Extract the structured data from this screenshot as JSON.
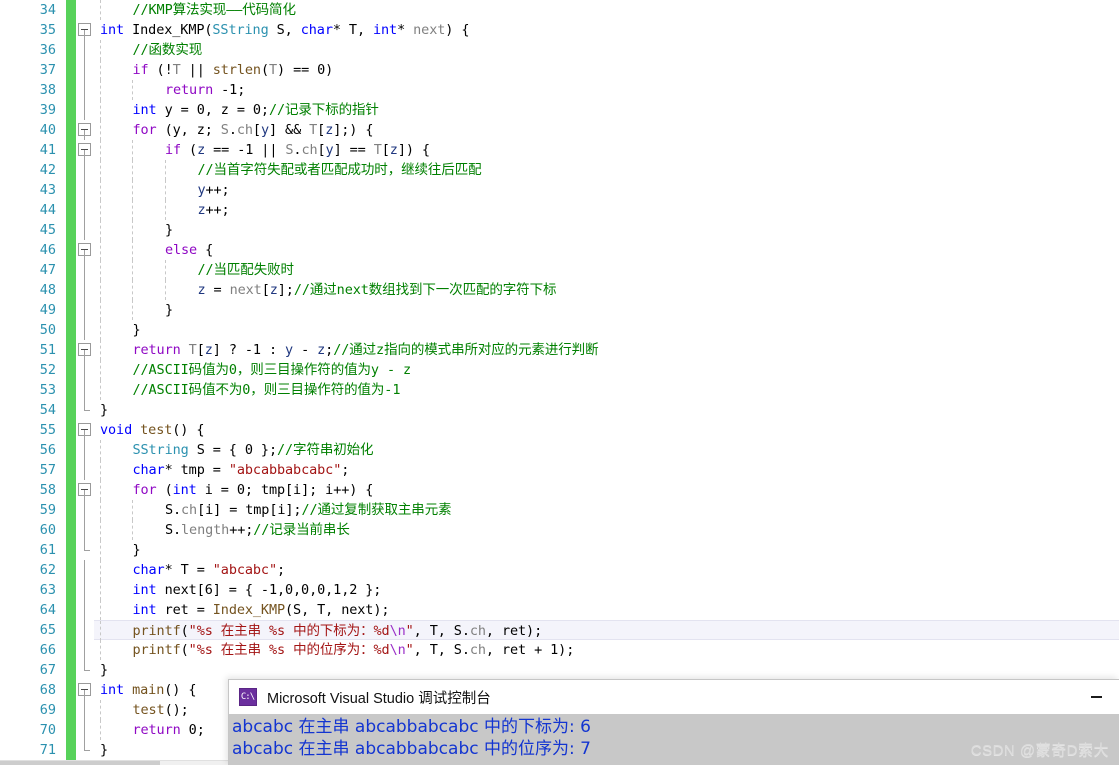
{
  "editor": {
    "language": "cpp",
    "gutter": {
      "change_bar_color": "#57d25a",
      "line_number_color": "#2b91af"
    },
    "first_line_number": 34,
    "current_line_number": 65,
    "lines": [
      {
        "n": 34,
        "indent": 1,
        "tokens": [
          [
            "cmt",
            "//KMP算法实现——代码简化"
          ]
        ]
      },
      {
        "n": 35,
        "indent": 0,
        "fold": "box",
        "tokens": [
          [
            "kw",
            "int"
          ],
          [
            "id",
            " Index_KMP("
          ],
          [
            "type",
            "SString"
          ],
          [
            "id",
            " S, "
          ],
          [
            "kw",
            "char"
          ],
          [
            "id",
            "* T, "
          ],
          [
            "kw",
            "int"
          ],
          [
            "id",
            "* "
          ],
          [
            "var",
            "next"
          ],
          [
            "id",
            ") {"
          ]
        ]
      },
      {
        "n": 36,
        "indent": 1,
        "fold": "line",
        "tokens": [
          [
            "cmt",
            "//函数实现"
          ]
        ]
      },
      {
        "n": 37,
        "indent": 1,
        "fold": "line",
        "tokens": [
          [
            "ctl",
            "if"
          ],
          [
            "id",
            " (!"
          ],
          [
            "var",
            "T"
          ],
          [
            "id",
            " || "
          ],
          [
            "fn",
            "strlen"
          ],
          [
            "id",
            "("
          ],
          [
            "var",
            "T"
          ],
          [
            "id",
            ") == 0)"
          ]
        ]
      },
      {
        "n": 38,
        "indent": 2,
        "fold": "line",
        "tokens": [
          [
            "ctl",
            "return"
          ],
          [
            "id",
            " -1;"
          ]
        ]
      },
      {
        "n": 39,
        "indent": 1,
        "fold": "line",
        "tokens": [
          [
            "kw",
            "int"
          ],
          [
            "id",
            " y = 0, z = 0;"
          ],
          [
            "cmt",
            "//记录下标的指针"
          ]
        ]
      },
      {
        "n": 40,
        "indent": 1,
        "fold": "box",
        "tokens": [
          [
            "ctl",
            "for"
          ],
          [
            "id",
            " (y, z; "
          ],
          [
            "var",
            "S"
          ],
          [
            "id",
            "."
          ],
          [
            "var",
            "ch"
          ],
          [
            "id",
            "["
          ],
          [
            "loc",
            "y"
          ],
          [
            "id",
            "] && "
          ],
          [
            "var",
            "T"
          ],
          [
            "id",
            "["
          ],
          [
            "loc",
            "z"
          ],
          [
            "id",
            "];) {"
          ]
        ]
      },
      {
        "n": 41,
        "indent": 2,
        "fold": "box",
        "tokens": [
          [
            "ctl",
            "if"
          ],
          [
            "id",
            " ("
          ],
          [
            "loc",
            "z"
          ],
          [
            "id",
            " == -1 || "
          ],
          [
            "var",
            "S"
          ],
          [
            "id",
            "."
          ],
          [
            "var",
            "ch"
          ],
          [
            "id",
            "["
          ],
          [
            "loc",
            "y"
          ],
          [
            "id",
            "] == "
          ],
          [
            "var",
            "T"
          ],
          [
            "id",
            "["
          ],
          [
            "loc",
            "z"
          ],
          [
            "id",
            "]) {"
          ]
        ]
      },
      {
        "n": 42,
        "indent": 3,
        "fold": "line",
        "tokens": [
          [
            "cmt",
            "//当首字符失配或者匹配成功时，继续往后匹配"
          ]
        ]
      },
      {
        "n": 43,
        "indent": 3,
        "fold": "line",
        "tokens": [
          [
            "loc",
            "y"
          ],
          [
            "id",
            "++;"
          ]
        ]
      },
      {
        "n": 44,
        "indent": 3,
        "fold": "line",
        "tokens": [
          [
            "loc",
            "z"
          ],
          [
            "id",
            "++;"
          ]
        ]
      },
      {
        "n": 45,
        "indent": 2,
        "fold": "line",
        "tokens": [
          [
            "id",
            "}"
          ]
        ]
      },
      {
        "n": 46,
        "indent": 2,
        "fold": "box",
        "tokens": [
          [
            "ctl",
            "else"
          ],
          [
            "id",
            " {"
          ]
        ]
      },
      {
        "n": 47,
        "indent": 3,
        "fold": "line",
        "tokens": [
          [
            "cmt",
            "//当匹配失败时"
          ]
        ]
      },
      {
        "n": 48,
        "indent": 3,
        "fold": "line",
        "tokens": [
          [
            "loc",
            "z"
          ],
          [
            "id",
            " = "
          ],
          [
            "var",
            "next"
          ],
          [
            "id",
            "["
          ],
          [
            "loc",
            "z"
          ],
          [
            "id",
            "];"
          ],
          [
            "cmt",
            "//通过next数组找到下一次匹配的字符下标"
          ]
        ]
      },
      {
        "n": 49,
        "indent": 2,
        "fold": "line",
        "tokens": [
          [
            "id",
            "}"
          ]
        ]
      },
      {
        "n": 50,
        "indent": 1,
        "fold": "line",
        "tokens": [
          [
            "id",
            "}"
          ]
        ]
      },
      {
        "n": 51,
        "indent": 1,
        "fold": "box",
        "tokens": [
          [
            "ctl",
            "return"
          ],
          [
            "id",
            " "
          ],
          [
            "var",
            "T"
          ],
          [
            "id",
            "["
          ],
          [
            "loc",
            "z"
          ],
          [
            "id",
            "] ? -1 : "
          ],
          [
            "loc",
            "y"
          ],
          [
            "id",
            " - "
          ],
          [
            "loc",
            "z"
          ],
          [
            "id",
            ";"
          ],
          [
            "cmt",
            "//通过z指向的模式串所对应的元素进行判断"
          ]
        ]
      },
      {
        "n": 52,
        "indent": 1,
        "fold": "line",
        "tokens": [
          [
            "cmt",
            "//ASCII码值为0，则三目操作符的值为y - z"
          ]
        ]
      },
      {
        "n": 53,
        "indent": 1,
        "fold": "line",
        "tokens": [
          [
            "cmt",
            "//ASCII码值不为0，则三目操作符的值为-1"
          ]
        ]
      },
      {
        "n": 54,
        "indent": 0,
        "fold": "endline",
        "tokens": [
          [
            "id",
            "}"
          ]
        ]
      },
      {
        "n": 55,
        "indent": 0,
        "fold": "box",
        "tokens": [
          [
            "kw",
            "void"
          ],
          [
            "id",
            " "
          ],
          [
            "fn",
            "test"
          ],
          [
            "id",
            "() {"
          ]
        ]
      },
      {
        "n": 56,
        "indent": 1,
        "fold": "line",
        "tokens": [
          [
            "type",
            "SString"
          ],
          [
            "id",
            " S = { 0 };"
          ],
          [
            "cmt",
            "//字符串初始化"
          ]
        ]
      },
      {
        "n": 57,
        "indent": 1,
        "fold": "line",
        "tokens": [
          [
            "kw",
            "char"
          ],
          [
            "id",
            "* tmp = "
          ],
          [
            "str",
            "\"abcabbabcabc\""
          ],
          [
            "id",
            ";"
          ]
        ]
      },
      {
        "n": 58,
        "indent": 1,
        "fold": "box",
        "tokens": [
          [
            "ctl",
            "for"
          ],
          [
            "id",
            " ("
          ],
          [
            "kw",
            "int"
          ],
          [
            "id",
            " i = 0; tmp[i]; i++) {"
          ]
        ]
      },
      {
        "n": 59,
        "indent": 2,
        "fold": "line",
        "tokens": [
          [
            "id",
            "S."
          ],
          [
            "var",
            "ch"
          ],
          [
            "id",
            "[i] = tmp[i];"
          ],
          [
            "cmt",
            "//通过复制获取主串元素"
          ]
        ]
      },
      {
        "n": 60,
        "indent": 2,
        "fold": "line",
        "tokens": [
          [
            "id",
            "S."
          ],
          [
            "var",
            "length"
          ],
          [
            "id",
            "++;"
          ],
          [
            "cmt",
            "//记录当前串长"
          ]
        ]
      },
      {
        "n": 61,
        "indent": 1,
        "fold": "endline",
        "tokens": [
          [
            "id",
            "}"
          ]
        ]
      },
      {
        "n": 62,
        "indent": 1,
        "fold": "line",
        "tokens": [
          [
            "kw",
            "char"
          ],
          [
            "id",
            "* T = "
          ],
          [
            "str",
            "\"abcabc\""
          ],
          [
            "id",
            ";"
          ]
        ]
      },
      {
        "n": 63,
        "indent": 1,
        "fold": "line",
        "tokens": [
          [
            "kw",
            "int"
          ],
          [
            "id",
            " next[6] = { -1,0,0,0,1,2 };"
          ]
        ]
      },
      {
        "n": 64,
        "indent": 1,
        "fold": "line",
        "tokens": [
          [
            "kw",
            "int"
          ],
          [
            "id",
            " ret = "
          ],
          [
            "fn",
            "Index_KMP"
          ],
          [
            "id",
            "(S, T, next);"
          ]
        ]
      },
      {
        "n": 65,
        "indent": 1,
        "fold": "line",
        "current": true,
        "tokens": [
          [
            "fn",
            "printf"
          ],
          [
            "id",
            "("
          ],
          [
            "str",
            "\"%s 在主串 %s 中的下标为："
          ],
          [
            "str",
            "%d"
          ],
          [
            "esc",
            "\\n"
          ],
          [
            "str",
            "\""
          ],
          [
            "id",
            ", T, S."
          ],
          [
            "var",
            "ch"
          ],
          [
            "id",
            ", ret);"
          ]
        ]
      },
      {
        "n": 66,
        "indent": 1,
        "fold": "line",
        "tokens": [
          [
            "fn",
            "printf"
          ],
          [
            "id",
            "("
          ],
          [
            "str",
            "\"%s 在主串 %s 中的位序为："
          ],
          [
            "str",
            "%d"
          ],
          [
            "esc",
            "\\n"
          ],
          [
            "str",
            "\""
          ],
          [
            "id",
            ", T, S."
          ],
          [
            "var",
            "ch"
          ],
          [
            "id",
            ", ret + 1);"
          ]
        ]
      },
      {
        "n": 67,
        "indent": 0,
        "fold": "endline",
        "tokens": [
          [
            "id",
            "}"
          ]
        ]
      },
      {
        "n": 68,
        "indent": 0,
        "fold": "box",
        "tokens": [
          [
            "kw",
            "int"
          ],
          [
            "id",
            " "
          ],
          [
            "fn",
            "main"
          ],
          [
            "id",
            "() {"
          ]
        ]
      },
      {
        "n": 69,
        "indent": 1,
        "fold": "line",
        "tokens": [
          [
            "fn",
            "test"
          ],
          [
            "id",
            "();"
          ]
        ]
      },
      {
        "n": 70,
        "indent": 1,
        "fold": "line",
        "tokens": [
          [
            "ctl",
            "return"
          ],
          [
            "id",
            " 0;"
          ]
        ]
      },
      {
        "n": 71,
        "indent": 0,
        "fold": "endline",
        "tokens": [
          [
            "id",
            "}"
          ]
        ]
      }
    ]
  },
  "console": {
    "icon": "console-app-icon",
    "title": "Microsoft Visual Studio 调试控制台",
    "minimize_label": "—",
    "output_lines": [
      "abcabc 在主串 abcabbabcabc 中的下标为: 6",
      "abcabc 在主串 abcabbabcabc 中的位序为: 7"
    ],
    "background_color": "#c8c8c8",
    "text_color": "#1335d1"
  },
  "watermark": {
    "text": "CSDN @蒙奇D索大"
  }
}
